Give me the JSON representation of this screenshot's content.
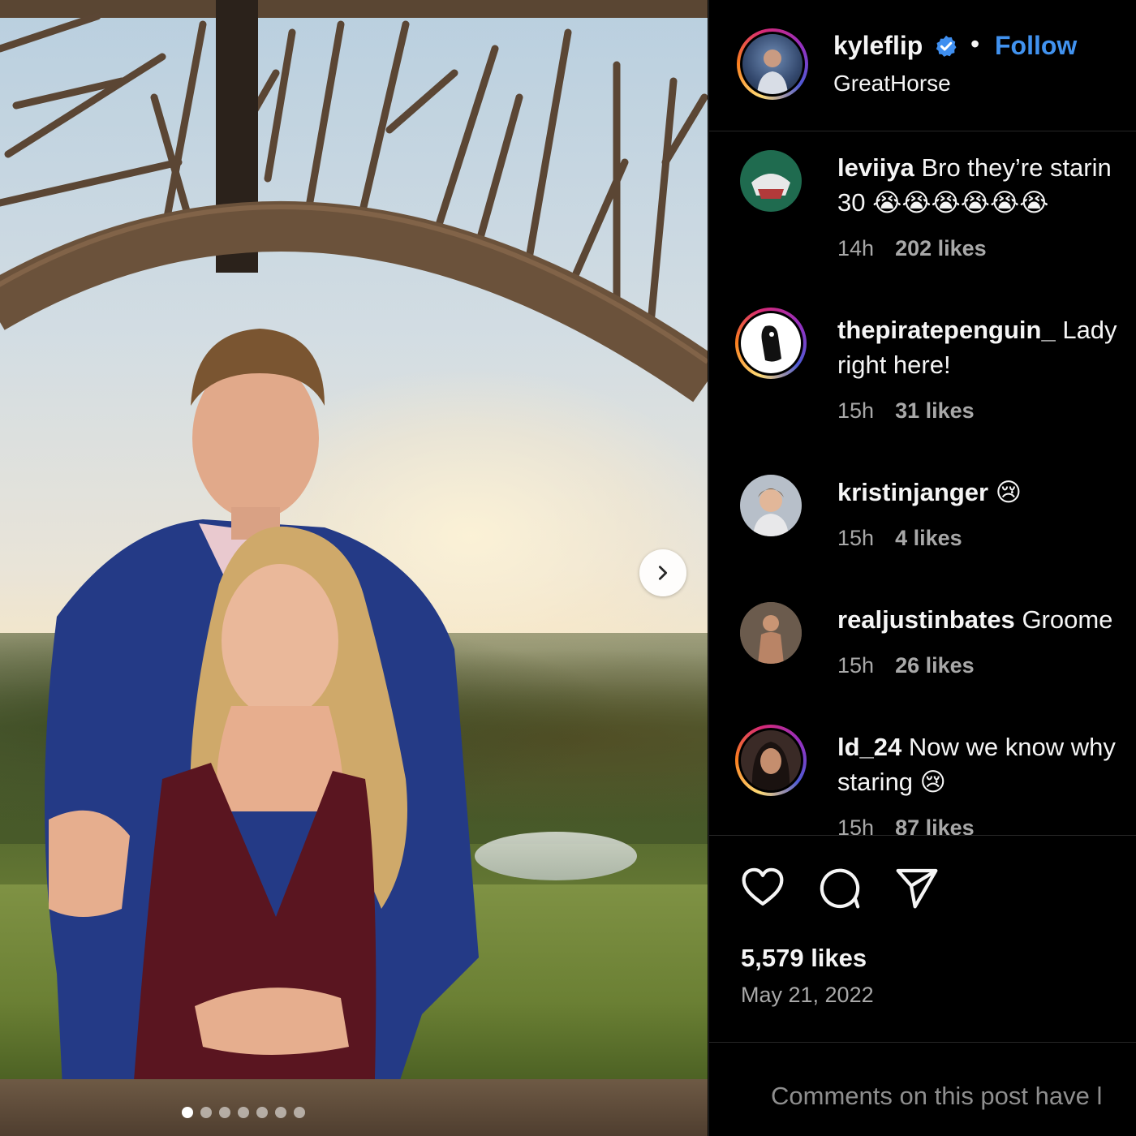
{
  "post": {
    "owner": {
      "username": "kyleflip",
      "verified": true,
      "subtitle": "GreatHorse",
      "follow_label": "Follow",
      "separator": "•"
    },
    "comments": [
      {
        "user": "leviiya",
        "text_line1": "Bro they’re starin",
        "text_line2": "30 😭😭😭😭😭😭",
        "time": "14h",
        "likes": "202 likes",
        "avatar_ring": false,
        "avatar_color": "#1f6b4f"
      },
      {
        "user": "thepiratepenguin_",
        "text_line1": "Lady",
        "text_line2": "right here!",
        "time": "15h",
        "likes": "31 likes",
        "avatar_ring": true,
        "avatar_color": "#ffffff"
      },
      {
        "user": "kristinjanger",
        "text_line1": "😢",
        "text_line2": "",
        "time": "15h",
        "likes": "4 likes",
        "avatar_ring": false,
        "avatar_color": "#b7bfc9"
      },
      {
        "user": "realjustinbates",
        "text_line1": "Groome",
        "text_line2": "",
        "time": "15h",
        "likes": "26 likes",
        "avatar_ring": false,
        "avatar_color": "#5a4b3e"
      },
      {
        "user": "ld_24",
        "text_line1": "Now we know why",
        "text_line2": "staring 😢",
        "time": "15h",
        "likes": "87 likes",
        "avatar_ring": true,
        "avatar_color": "#3a2a26"
      }
    ],
    "actions": {
      "like_icon": "heart-icon",
      "comment_icon": "comment-icon",
      "share_icon": "send-icon"
    },
    "likes_total": "5,579 likes",
    "date": "May 21, 2022",
    "comments_notice": "Comments on this post have l",
    "carousel": {
      "count": 7,
      "active": 0,
      "next_icon": "chevron-right-icon"
    }
  },
  "colors": {
    "accent": "#4192ef",
    "muted": "#a8a8a8",
    "border": "#262626"
  }
}
